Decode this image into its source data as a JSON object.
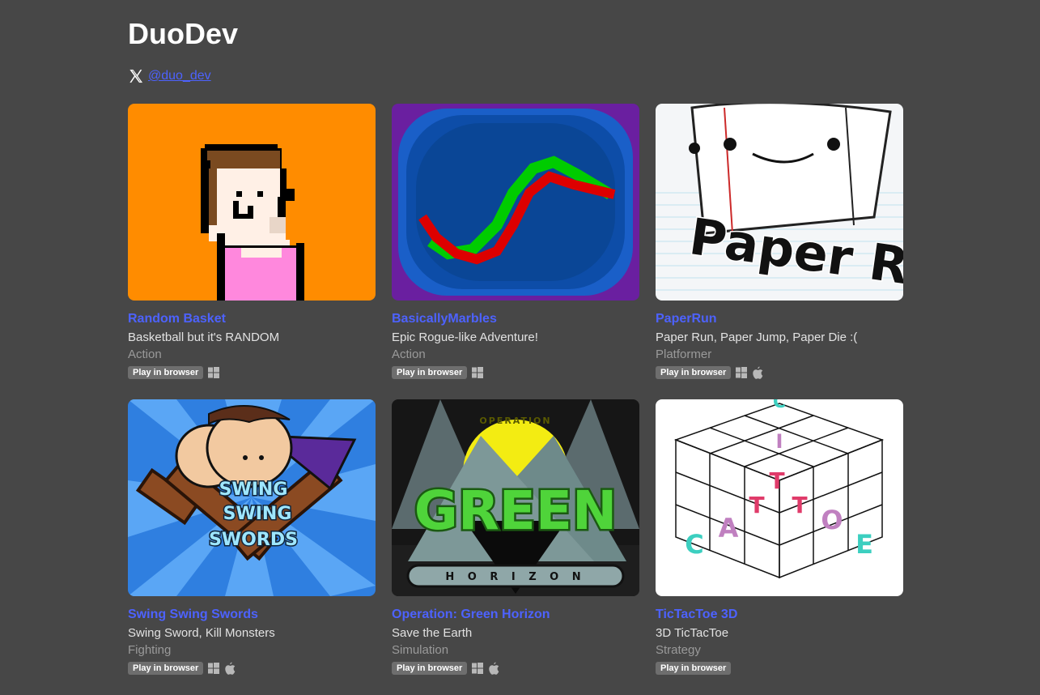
{
  "developer": {
    "name": "DuoDev",
    "social_handle": "@duo_dev",
    "social_icon": "x-logo-icon"
  },
  "games": [
    {
      "title": "Random Basket",
      "description": "Basketball but it's RANDOM",
      "genre": "Action",
      "badge": "Play in browser",
      "platforms": [
        "windows-icon"
      ]
    },
    {
      "title": "BasicallyMarbles",
      "description": "Epic Rogue-like Adventure!",
      "genre": "Action",
      "badge": "Play in browser",
      "platforms": [
        "windows-icon"
      ]
    },
    {
      "title": "PaperRun",
      "description": "Paper Run, Paper Jump, Paper Die :(",
      "genre": "Platformer",
      "badge": "Play in browser",
      "platforms": [
        "windows-icon",
        "apple-icon"
      ],
      "cover_text": "Paper Run"
    },
    {
      "title": "Swing Swing Swords",
      "description": "Swing Sword, Kill Monsters",
      "genre": "Fighting",
      "badge": "Play in browser",
      "platforms": [
        "windows-icon",
        "apple-icon"
      ],
      "cover_text": [
        "SWING",
        "SWING",
        "SWORDS"
      ]
    },
    {
      "title": "Operation: Green Horizon",
      "description": "Save the Earth",
      "genre": "Simulation",
      "badge": "Play in browser",
      "platforms": [
        "windows-icon",
        "apple-icon"
      ],
      "cover_text": {
        "top": "OPERATION",
        "main": "GREEN",
        "bottom": "H O R I Z O N"
      }
    },
    {
      "title": "TicTacToe 3D",
      "description": "3D TicTacToe",
      "genre": "Strategy",
      "badge": "Play in browser",
      "platforms": []
    }
  ],
  "colors": {
    "background": "#474747",
    "link": "#4d62ff",
    "badge": "#6e6e6e"
  }
}
